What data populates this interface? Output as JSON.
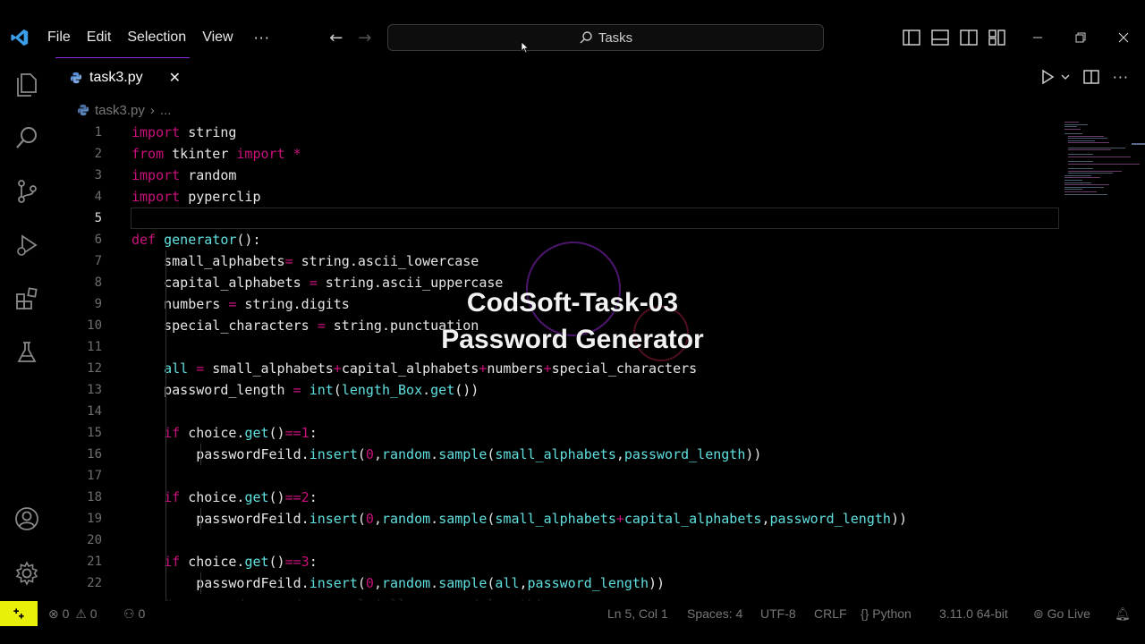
{
  "menu": {
    "file": "File",
    "edit": "Edit",
    "selection": "Selection",
    "view": "View",
    "more": "···"
  },
  "command_center": {
    "label": "Tasks"
  },
  "tab": {
    "label": "task3.py",
    "close": "✕"
  },
  "breadcrumb": {
    "file": "task3.py",
    "sep": "›",
    "rest": "..."
  },
  "overlay": {
    "line1": "CodSoft-Task-03",
    "line2": "Password Generator"
  },
  "code_lines": [
    {
      "n": "1",
      "html": "<span class='kw'>import</span> string"
    },
    {
      "n": "2",
      "html": "<span class='kw'>from</span> tkinter <span class='kw'>import</span> <span class='op'>*</span>"
    },
    {
      "n": "3",
      "html": "<span class='kw'>import</span> random"
    },
    {
      "n": "4",
      "html": "<span class='kw'>import</span> pyperclip"
    },
    {
      "n": "5",
      "html": ""
    },
    {
      "n": "6",
      "html": "<span class='kw'>def</span> <span class='fn'>generator</span>():"
    },
    {
      "n": "7",
      "html": "    small_alphabets<span class='op'>=</span> string.ascii_lowercase"
    },
    {
      "n": "8",
      "html": "    capital_alphabets <span class='op'>=</span> string.ascii_uppercase"
    },
    {
      "n": "9",
      "html": "    numbers <span class='op'>=</span> string.digits"
    },
    {
      "n": "10",
      "html": "    special_characters <span class='op'>=</span> string.punctuation"
    },
    {
      "n": "11",
      "html": ""
    },
    {
      "n": "12",
      "html": "    <span class='fn'>all</span> <span class='op'>=</span> small_alphabets<span class='op'>+</span>capital_alphabets<span class='op'>+</span>numbers<span class='op'>+</span>special_characters"
    },
    {
      "n": "13",
      "html": "    password_length <span class='op'>=</span> <span class='fn'>int</span>(<span class='fn'>length_Box</span>.<span class='fn'>get</span>())"
    },
    {
      "n": "14",
      "html": ""
    },
    {
      "n": "15",
      "html": "    <span class='kw'>if</span> choice.<span class='fn'>get</span>()<span class='op'>==</span><span class='num'>1</span>:"
    },
    {
      "n": "16",
      "html": "        passwordFeild.<span class='fn'>insert</span>(<span class='num'>0</span>,<span class='fn'>random</span>.<span class='fn'>sample</span>(<span class='fn'>small_alphabets</span>,<span class='fn'>password_length</span>))"
    },
    {
      "n": "17",
      "html": ""
    },
    {
      "n": "18",
      "html": "    <span class='kw'>if</span> choice.<span class='fn'>get</span>()<span class='op'>==</span><span class='num'>2</span>:"
    },
    {
      "n": "19",
      "html": "        passwordFeild.<span class='fn'>insert</span>(<span class='num'>0</span>,<span class='fn'>random</span>.<span class='fn'>sample</span>(<span class='fn'>small_alphabets</span><span class='op'>+</span><span class='fn'>capital_alphabets</span>,<span class='fn'>password_length</span>))"
    },
    {
      "n": "20",
      "html": ""
    },
    {
      "n": "21",
      "html": "    <span class='kw'>if</span> choice.<span class='fn'>get</span>()<span class='op'>==</span><span class='num'>3</span>:"
    },
    {
      "n": "22",
      "html": "        passwordFeild.<span class='fn'>insert</span>(<span class='num'>0</span>,<span class='fn'>random</span>.<span class='fn'>sample</span>(<span class='fn'>all</span>,<span class='fn'>password_length</span>))"
    }
  ],
  "status": {
    "errors": "0",
    "warnings": "0",
    "ports": "0",
    "position": "Ln 5, Col 1",
    "spaces": "Spaces: 4",
    "encoding": "UTF-8",
    "eol": "CRLF",
    "language": "Python",
    "interpreter": "3.11.0 64-bit",
    "golive": "Go Live"
  },
  "colors": {
    "accent": "#8a2be2",
    "remote": "#e8f00a",
    "keyword": "#c8117a",
    "function": "#5fe0e0"
  }
}
